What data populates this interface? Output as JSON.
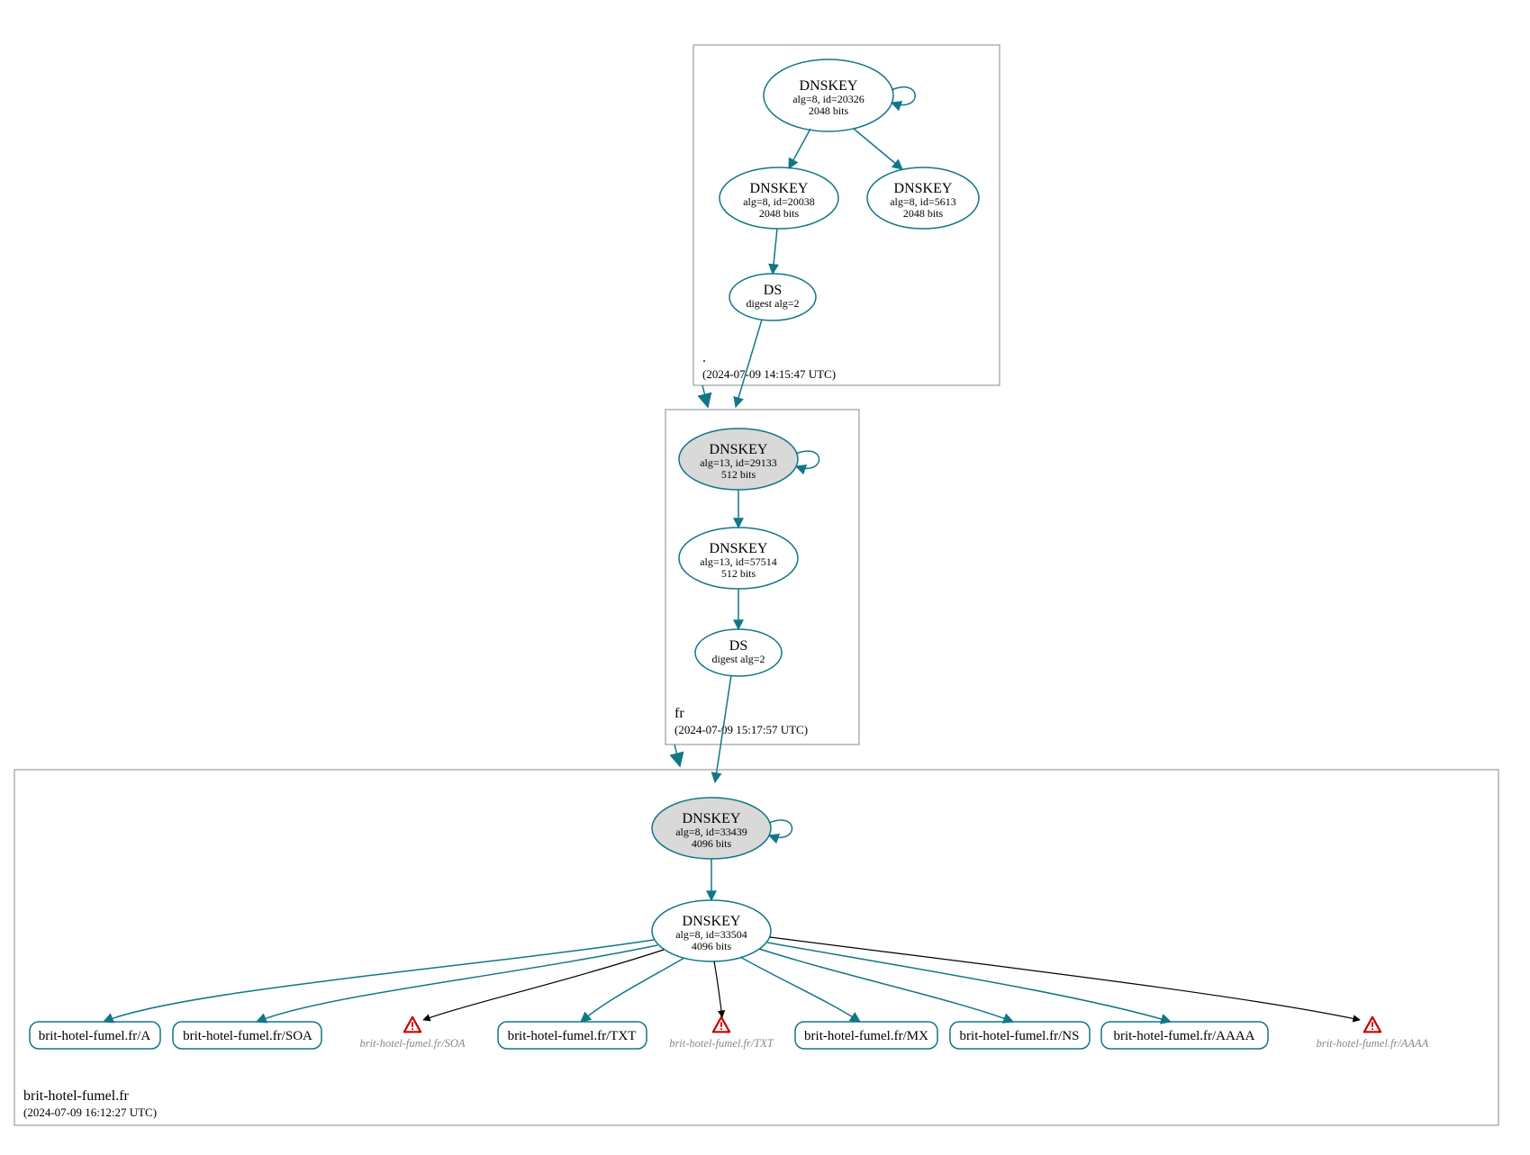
{
  "zones": {
    "root": {
      "label": ".",
      "time": "(2024-07-09 14:15:47 UTC)"
    },
    "fr": {
      "label": "fr",
      "time": "(2024-07-09 15:17:57 UTC)"
    },
    "leaf": {
      "label": "brit-hotel-fumel.fr",
      "time": "(2024-07-09 16:12:27 UTC)"
    }
  },
  "nodes": {
    "root_ksk": {
      "title": "DNSKEY",
      "sub1": "alg=8, id=20326",
      "sub2": "2048 bits"
    },
    "root_zsk1": {
      "title": "DNSKEY",
      "sub1": "alg=8, id=20038",
      "sub2": "2048 bits"
    },
    "root_zsk2": {
      "title": "DNSKEY",
      "sub1": "alg=8, id=5613",
      "sub2": "2048 bits"
    },
    "root_ds": {
      "title": "DS",
      "sub1": "digest alg=2",
      "sub2": ""
    },
    "fr_ksk": {
      "title": "DNSKEY",
      "sub1": "alg=13, id=29133",
      "sub2": "512 bits"
    },
    "fr_zsk": {
      "title": "DNSKEY",
      "sub1": "alg=13, id=57514",
      "sub2": "512 bits"
    },
    "fr_ds": {
      "title": "DS",
      "sub1": "digest alg=2",
      "sub2": ""
    },
    "leaf_ksk": {
      "title": "DNSKEY",
      "sub1": "alg=8, id=33439",
      "sub2": "4096 bits"
    },
    "leaf_zsk": {
      "title": "DNSKEY",
      "sub1": "alg=8, id=33504",
      "sub2": "4096 bits"
    }
  },
  "rr": {
    "a": "brit-hotel-fumel.fr/A",
    "soa": "brit-hotel-fumel.fr/SOA",
    "txt": "brit-hotel-fumel.fr/TXT",
    "mx": "brit-hotel-fumel.fr/MX",
    "ns": "brit-hotel-fumel.fr/NS",
    "aaaa": "brit-hotel-fumel.fr/AAAA"
  },
  "warnings": {
    "soa": "brit-hotel-fumel.fr/SOA",
    "txt": "brit-hotel-fumel.fr/TXT",
    "aaaa": "brit-hotel-fumel.fr/AAAA"
  }
}
